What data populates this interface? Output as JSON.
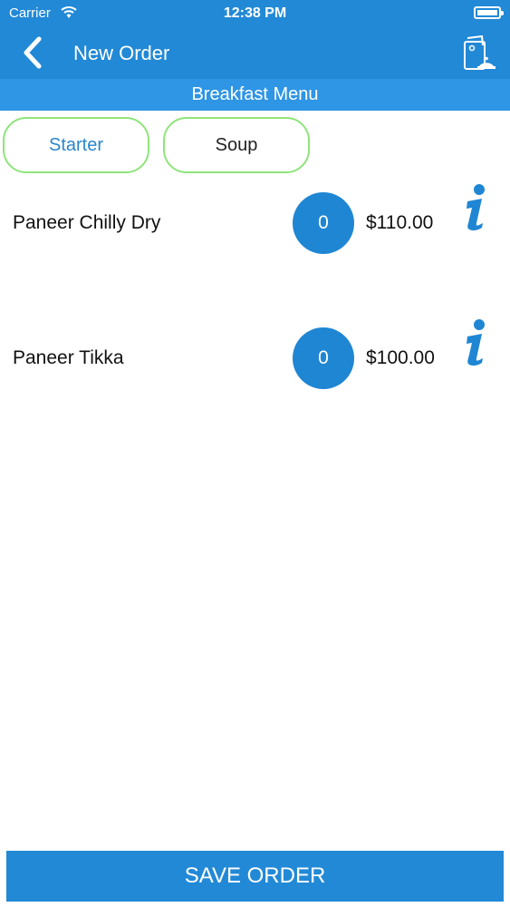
{
  "status_bar": {
    "carrier": "Carrier",
    "time": "12:38 PM"
  },
  "nav": {
    "title": "New Order"
  },
  "menu": {
    "title": "Breakfast Menu"
  },
  "categories": [
    {
      "label": "Starter",
      "selected": true
    },
    {
      "label": "Soup",
      "selected": false
    }
  ],
  "items": [
    {
      "name": "Paneer Chilly Dry",
      "quantity": "0",
      "price": "$110.00"
    },
    {
      "name": "Paneer Tikka",
      "quantity": "0",
      "price": "$100.00"
    }
  ],
  "footer": {
    "save_label": "SAVE ORDER"
  },
  "colors": {
    "primary": "#2289d6",
    "menu_bar": "#2f95e5",
    "tab_border": "#8fe47b",
    "selected_tab_text": "#2a86cc"
  }
}
